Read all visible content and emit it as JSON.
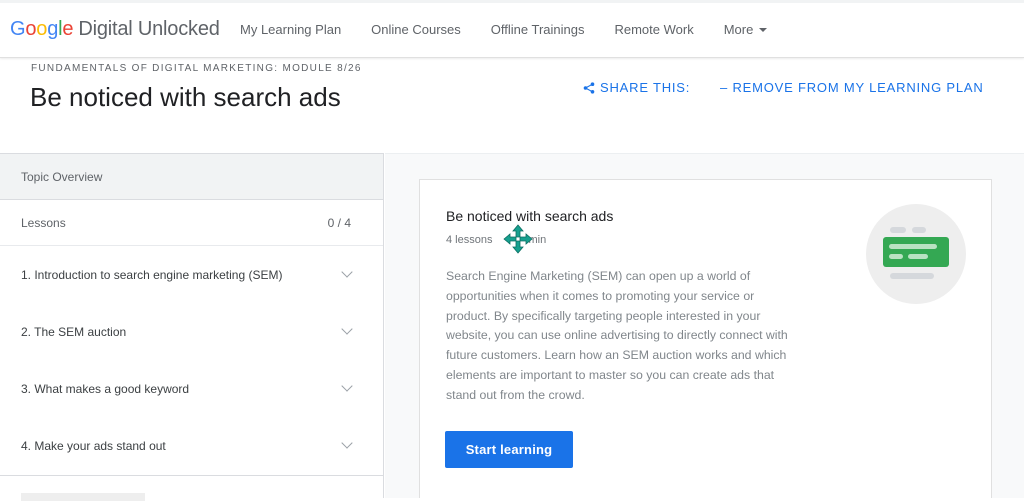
{
  "header": {
    "brand": {
      "g": "G",
      "o1": "o",
      "o2": "o",
      "g2": "g",
      "l": "l",
      "e": "e",
      "rest": "Digital Unlocked"
    },
    "nav": [
      "My Learning Plan",
      "Online Courses",
      "Offline Trainings",
      "Remote Work",
      "More"
    ]
  },
  "page": {
    "module_label": "FUNDAMENTALS OF DIGITAL MARKETING: MODULE 8/26",
    "title": "Be noticed with search ads",
    "share_label": "SHARE THIS:",
    "remove_label": "– REMOVE FROM MY LEARNING PLAN"
  },
  "sidebar": {
    "heading": "Topic Overview",
    "lessons_label": "Lessons",
    "progress": "0 / 4",
    "lessons": [
      "1. Introduction to search engine marketing (SEM)",
      "2. The SEM auction",
      "3. What makes a good keyword",
      "4. Make your ads stand out"
    ]
  },
  "card": {
    "title": "Be noticed with search ads",
    "lessons_count": "4 lessons",
    "duration": "min",
    "description": "Search Engine Marketing (SEM) can open up a world of opportunities when it comes to promoting your service or product. By specifically targeting people interested in your website, you can use online advertising to directly connect with future customers. Learn how an SEM auction works and which elements are important to master so you can create ads that stand out from the crowd.",
    "button_label": "Start learning"
  },
  "colors": {
    "accent": "#1a73e8",
    "illustration_green": "#34a853",
    "move_cursor": "#17a08f"
  },
  "icons": [
    "share-icon",
    "chevron-down-icon",
    "move-cursor-icon",
    "search-ad-illustration"
  ]
}
